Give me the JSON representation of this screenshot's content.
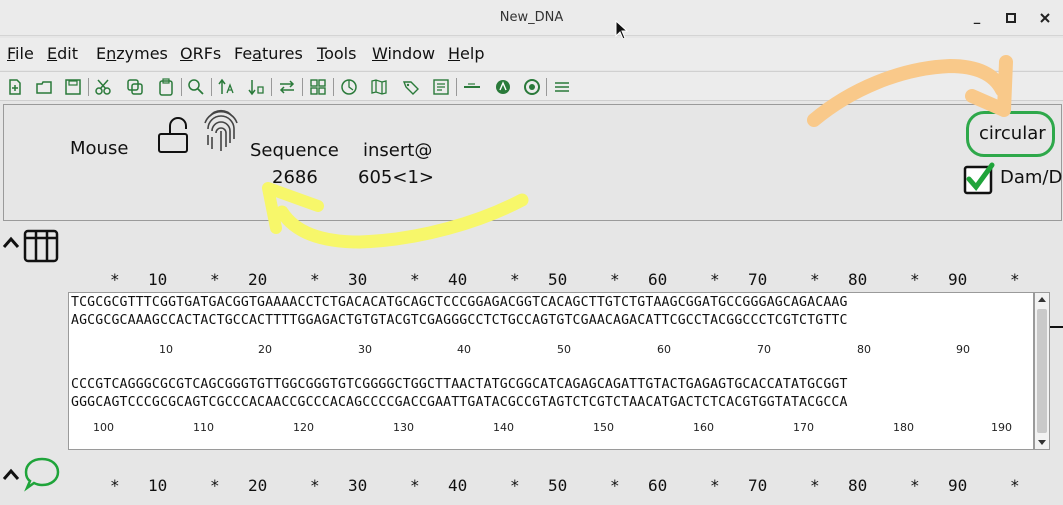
{
  "window": {
    "title": "New_DNA",
    "minimize": "_",
    "maximize": "▫",
    "close": "✕"
  },
  "menu": [
    {
      "mnemonic": "F",
      "rest": "ile"
    },
    {
      "mnemonic": "E",
      "rest": "dit"
    },
    {
      "pre": "E",
      "mnemonic": "n",
      "rest": "zymes"
    },
    {
      "mnemonic": "O",
      "rest": "RFs"
    },
    {
      "pre": "Fe",
      "mnemonic": "a",
      "rest": "tures"
    },
    {
      "mnemonic": "T",
      "rest": "ools"
    },
    {
      "mnemonic": "W",
      "rest": "indow"
    },
    {
      "mnemonic": "H",
      "rest": "elp"
    }
  ],
  "info": {
    "mouse_label": "Mouse",
    "sequence_label": "Sequence",
    "sequence_value": "2686",
    "insert_label": "insert@",
    "insert_value": "605<1>",
    "circular_label": "circular",
    "dam_label": "Dam/D",
    "dam_checked": true
  },
  "ruler": {
    "marks": [
      "*",
      "10",
      "*",
      "20",
      "*",
      "30",
      "*",
      "40",
      "*",
      "50",
      "*",
      "60",
      "*",
      "70",
      "*",
      "80",
      "*",
      "90",
      "*"
    ]
  },
  "sequence": {
    "block1_top": "TCGCGCGTTTCGGTGATGACGGTGAAAACCTCTGACACATGCAGCTCCCGGAGACGGTCACAGCTTGTCTGTAAGCGGATGCCGGGAGCAGACAAG",
    "block1_bottom": "AGCGCGCAAAGCCACTACTGCCACTTTTGGAGACTGTGTACGTCGAGGGCCTCTGCCAGTGTCGAACAGACATTCGCCTACGGCCCTCGTCTGTTC",
    "block1_positions": [
      "10",
      "20",
      "30",
      "40",
      "50",
      "60",
      "70",
      "80",
      "90"
    ],
    "block2_top": "CCCGTCAGGGCGCGTCAGCGGGTGTTGGCGGGTGTCGGGGCTGGCTTAACTATGCGGCATCAGAGCAGATTGTACTGAGAGTGCACCATATGCGGT",
    "block2_bottom": "GGGCAGTCCCGCGCAGTCGCCCACAACCGCCCACAGCCCCGACCGAATTGATACGCCGTAGTCTCGTCTAACATGACTCTCACGTGGTATACGCCA",
    "block2_positions": [
      "100",
      "110",
      "120",
      "130",
      "140",
      "150",
      "160",
      "170",
      "180",
      "190"
    ]
  },
  "annotation_colors": {
    "yellow_arrow": "#f7f76a",
    "orange_arrow": "#f9c98a",
    "circular_outline": "#2ea84a",
    "check_green": "#1fa43a"
  }
}
